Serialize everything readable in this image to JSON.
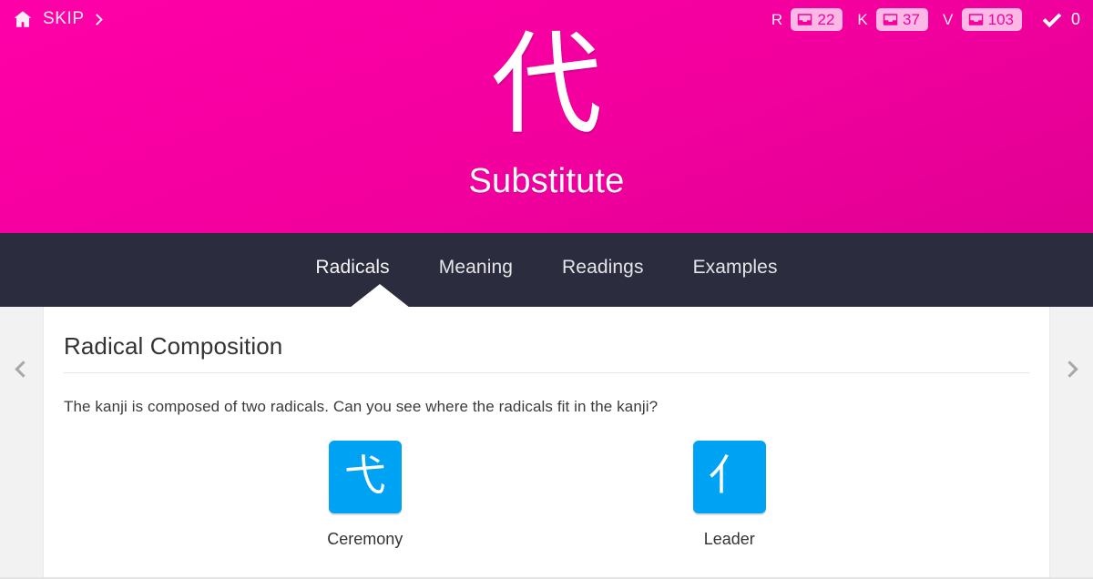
{
  "header": {
    "home_icon": "home-icon",
    "skip_label": "SKIP",
    "skip_chevron_icon": "chevron-right-icon",
    "kanji": "代",
    "meaning": "Substitute",
    "background_color": "#f5009f"
  },
  "stats": [
    {
      "letter": "R",
      "icon": "inbox-tray-icon",
      "count": "22"
    },
    {
      "letter": "K",
      "icon": "inbox-tray-icon",
      "count": "37"
    },
    {
      "letter": "V",
      "icon": "inbox-tray-icon",
      "count": "103"
    }
  ],
  "session": {
    "check_icon": "checkmark-icon",
    "correct_count": "0"
  },
  "tabs": [
    {
      "label": "Radicals",
      "active": true
    },
    {
      "label": "Meaning",
      "active": false
    },
    {
      "label": "Readings",
      "active": false
    },
    {
      "label": "Examples",
      "active": false
    }
  ],
  "tabbar": {
    "background_color": "#2b2d3e"
  },
  "content": {
    "prev_icon": "chevron-left-icon",
    "next_icon": "chevron-right-icon",
    "section_title": "Radical Composition",
    "description": "The kanji is composed of two radicals. Can you see where the radicals fit in the kanji?",
    "radicals": [
      {
        "glyph": "弋",
        "label": "Ceremony",
        "color": "#00a2f3"
      },
      {
        "glyph": "亻",
        "label": "Leader",
        "color": "#00a2f3"
      }
    ]
  }
}
